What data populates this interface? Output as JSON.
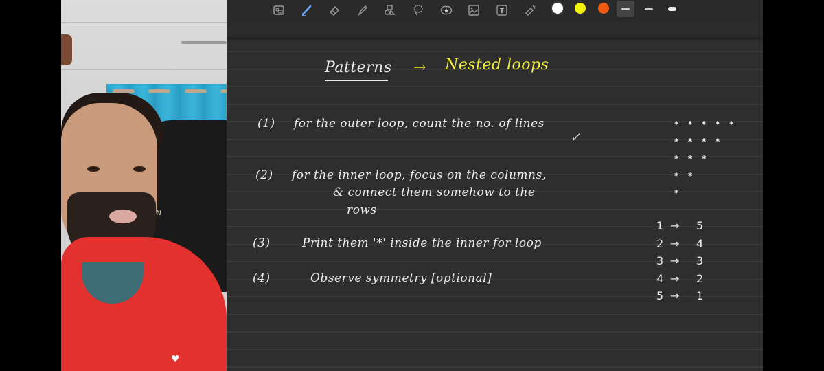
{
  "toolbar": {
    "tools": [
      {
        "name": "lasso-select-image",
        "icon": "selection-icon"
      },
      {
        "name": "pen",
        "icon": "pen-icon",
        "active": true
      },
      {
        "name": "eraser",
        "icon": "eraser-icon"
      },
      {
        "name": "highlighter",
        "icon": "highlighter-icon"
      },
      {
        "name": "shapes",
        "icon": "shapes-icon"
      },
      {
        "name": "lasso",
        "icon": "lasso-icon"
      },
      {
        "name": "sticker",
        "icon": "sticker-icon"
      },
      {
        "name": "image",
        "icon": "image-icon"
      },
      {
        "name": "text",
        "icon": "text-icon",
        "glyph": "T"
      },
      {
        "name": "laser-pointer",
        "icon": "laser-pointer-icon"
      }
    ],
    "colors": [
      {
        "name": "white",
        "hex": "#ffffff"
      },
      {
        "name": "yellow",
        "hex": "#f5f20a"
      },
      {
        "name": "orange",
        "hex": "#f25a0f",
        "selected": false
      }
    ],
    "stroke_widths": [
      {
        "name": "thin",
        "selected": true
      },
      {
        "name": "medium",
        "selected": false
      },
      {
        "name": "thick",
        "selected": false
      }
    ]
  },
  "notes": {
    "title": "Patterns",
    "arrow": "→",
    "subtitle": "Nested loops",
    "steps": [
      {
        "number": "(1)",
        "text": "for the outer loop, count the no. of lines",
        "mark": "✓"
      },
      {
        "number": "(2)",
        "text": "for the inner loop, focus on the columns,",
        "continuation": [
          "& connect them somehow to the",
          "rows"
        ]
      },
      {
        "number": "(3)",
        "text": "Print them '*'  inside the inner for loop"
      },
      {
        "number": "(4)",
        "text": "Observe    symmetry    [optional]"
      }
    ],
    "star_pattern": [
      [
        "*",
        "*",
        "*",
        "*",
        "*"
      ],
      [
        "*",
        "*",
        "*",
        "*"
      ],
      [
        "*",
        "*",
        "*"
      ],
      [
        "*",
        "*"
      ],
      [
        "*"
      ]
    ],
    "row_mapping": [
      {
        "row": "1",
        "arrow": "→",
        "count": "5"
      },
      {
        "row": "2",
        "arrow": "→",
        "count": "4"
      },
      {
        "row": "3",
        "arrow": "→",
        "count": "3"
      },
      {
        "row": "4",
        "arrow": "→",
        "count": "2"
      },
      {
        "row": "5",
        "arrow": "→",
        "count": "1"
      }
    ]
  },
  "webcam": {
    "chair_text": "EN",
    "hoodie_logo": "♥"
  }
}
